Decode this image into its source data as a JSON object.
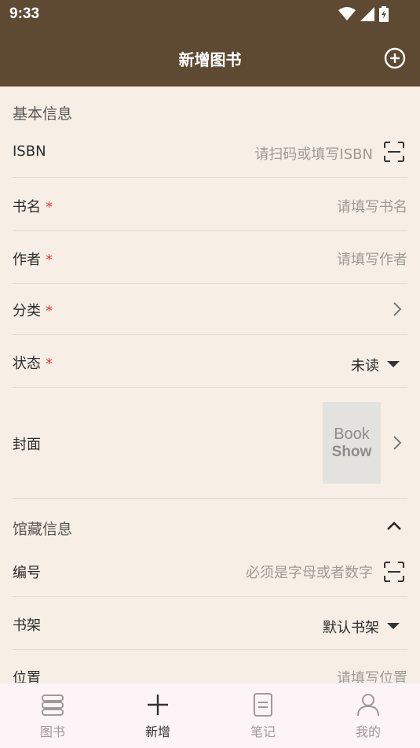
{
  "status_bar": {
    "time": "9:33"
  },
  "app_bar": {
    "title": "新增图书"
  },
  "sections": {
    "basic": {
      "title": "基本信息"
    },
    "collection": {
      "title": "馆藏信息"
    }
  },
  "fields": {
    "isbn": {
      "label": "ISBN",
      "placeholder": "请扫码或填写ISBN"
    },
    "title": {
      "label": "书名",
      "required": "*",
      "placeholder": "请填写书名"
    },
    "author": {
      "label": "作者",
      "required": "*",
      "placeholder": "请填写作者"
    },
    "category": {
      "label": "分类",
      "required": "*"
    },
    "status": {
      "label": "状态",
      "required": "*",
      "value": "未读"
    },
    "cover": {
      "label": "封面",
      "image_text_1": "Book",
      "image_text_2": "Show"
    },
    "number": {
      "label": "编号",
      "placeholder": "必须是字母或者数字"
    },
    "shelf": {
      "label": "书架",
      "value": "默认书架"
    },
    "location": {
      "label": "位置",
      "placeholder": "请填写位置"
    }
  },
  "tabs": [
    {
      "label": "图书",
      "icon": "books-icon"
    },
    {
      "label": "新增",
      "icon": "plus-icon",
      "active": true
    },
    {
      "label": "笔记",
      "icon": "note-icon"
    },
    {
      "label": "我的",
      "icon": "person-icon"
    }
  ],
  "colors": {
    "header": "#5e4a33",
    "background": "#f7efe6",
    "required": "#e53935"
  }
}
